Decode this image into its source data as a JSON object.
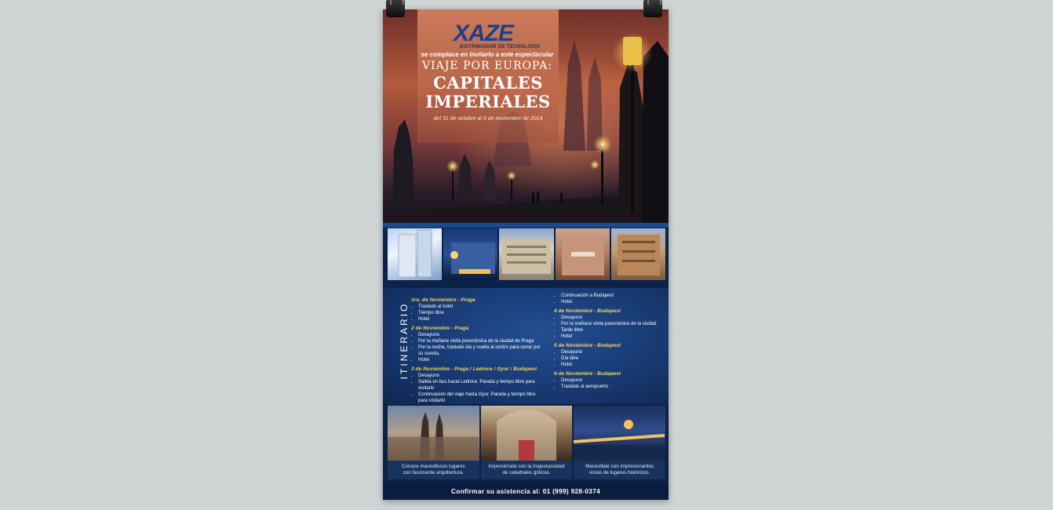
{
  "brand": {
    "logo": "XAZE",
    "tagline": "DISTRIBUIDOR DE TECNOLOGÍA"
  },
  "hero": {
    "invite": "se complace en invitarlo a este espectacular",
    "trip_line": "VIAJE POR EUROPA:",
    "title_line1": "CAPITALES",
    "title_line2": "IMPERIALES",
    "dates": "del 31 de octubre al 6 de noviembre de 2014"
  },
  "itinerary": {
    "label": "ITINERARIO",
    "left": [
      {
        "day": "1ro. de Noviembre - Praga",
        "items": [
          "Traslado al hotel",
          "Tiempo libre",
          "Hotel"
        ]
      },
      {
        "day": "2 de Noviembre - Praga",
        "items": [
          "Desayuno",
          "Por la mañana visita panorámica de la ciudad de Praga",
          "Por la noche, traslado ida y vuelta al centro para cenar por su cuenta.",
          "Hotel"
        ]
      },
      {
        "day": "3 de Noviembre - Praga / Lednice / Gyor / Budapest",
        "items": [
          "Desayuno",
          "Salida en bus hacia Lednice. Parada y tiempo libre para visitarlo",
          "Continuación del viaje hasta Gyor. Parada y tiempo libre para visitarlo"
        ]
      }
    ],
    "right_top": [
      "Continuación a Budapest",
      "Hotel"
    ],
    "right": [
      {
        "day": "4 de Noviembre - Budapest",
        "items": [
          "Desayuno",
          "Por la mañana visita panorámica de la ciudad",
          "Tarde libre",
          "Hotel"
        ]
      },
      {
        "day": "5 de Noviembre - Budapest",
        "items": [
          "Desayuno",
          "Día libre",
          "Hotel"
        ]
      },
      {
        "day": "6 de Noviembre - Budapest",
        "items": [
          "Desayuno",
          "Traslado al aeropuerto"
        ]
      }
    ]
  },
  "gallery": [
    {
      "caption1": "Conoce maravillosos lugares",
      "caption2": "con fascinante arquitectura."
    },
    {
      "caption1": "Impresiónate con la majestuosidad",
      "caption2": "de catedrales góticas."
    },
    {
      "caption1": "Maravíllate con impresionantes",
      "caption2": "vistas de lugares históricos."
    }
  ],
  "footer": {
    "confirm": "Confirmar su asistencia al: 01 (999) 928-0374"
  }
}
